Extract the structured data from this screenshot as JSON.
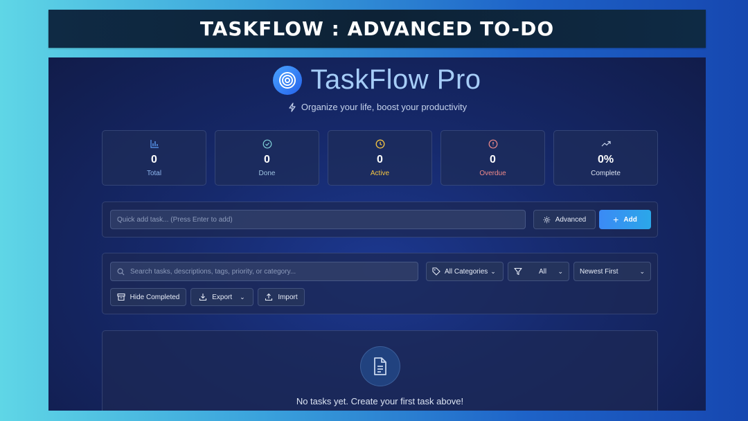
{
  "banner": {
    "title": "TASKFLOW : ADVANCED TO-DO"
  },
  "brand": {
    "title": "TaskFlow Pro",
    "tagline": "Organize your life, boost your productivity",
    "logo_icon": "target-icon"
  },
  "stats": [
    {
      "value": "0",
      "label": "Total",
      "icon": "bar-chart-icon",
      "color": "#5b9cf5"
    },
    {
      "value": "0",
      "label": "Done",
      "icon": "check-circle-icon",
      "color": "#7fd0d8"
    },
    {
      "value": "0",
      "label": "Active",
      "icon": "clock-icon",
      "color": "#f5c542"
    },
    {
      "value": "0",
      "label": "Overdue",
      "icon": "alert-circle-icon",
      "color": "#f08a8a"
    },
    {
      "value": "0%",
      "label": "Complete",
      "icon": "trending-up-icon",
      "color": "#c9d6ee"
    }
  ],
  "quick_add": {
    "placeholder": "Quick add task... (Press Enter to add)",
    "advanced_label": "Advanced",
    "add_label": "Add"
  },
  "filters": {
    "search_placeholder": "Search tasks, descriptions, tags, priority, or category...",
    "category_selected": "All Categories",
    "status_selected": "All",
    "sort_selected": "Newest First",
    "hide_completed_label": "Hide Completed",
    "export_label": "Export",
    "import_label": "Import"
  },
  "empty_state": {
    "message": "No tasks yet. Create your first task above!"
  },
  "colors": {
    "accent": "#3b8af5",
    "background": "#16296b"
  }
}
